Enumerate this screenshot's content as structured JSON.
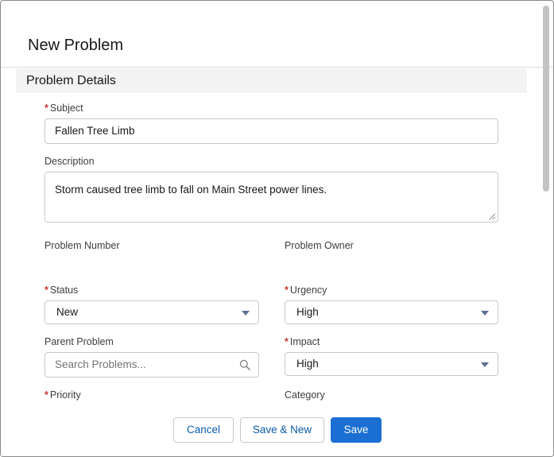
{
  "modal": {
    "title": "New Problem"
  },
  "section": {
    "title": "Problem Details"
  },
  "fields": {
    "subject": {
      "label": "Subject",
      "value": "Fallen Tree Limb",
      "required": true
    },
    "description": {
      "label": "Description",
      "value": "Storm caused tree limb to fall on Main Street power lines."
    },
    "problem_number": {
      "label": "Problem Number"
    },
    "problem_owner": {
      "label": "Problem Owner"
    },
    "status": {
      "label": "Status",
      "value": "New",
      "required": true
    },
    "urgency": {
      "label": "Urgency",
      "value": "High",
      "required": true
    },
    "parent_problem": {
      "label": "Parent Problem",
      "placeholder": "Search Problems..."
    },
    "impact": {
      "label": "Impact",
      "value": "High",
      "required": true
    },
    "priority": {
      "label": "Priority",
      "required": true
    },
    "category": {
      "label": "Category"
    }
  },
  "footer": {
    "cancel_label": "Cancel",
    "save_new_label": "Save & New",
    "save_label": "Save"
  },
  "icons": {
    "dropdown": "chevron-down-icon",
    "search": "search-icon",
    "required": "asterisk"
  },
  "colors": {
    "brand": "#1b6fd3",
    "required": "#c23934",
    "section_bg": "#f3f3f3"
  }
}
